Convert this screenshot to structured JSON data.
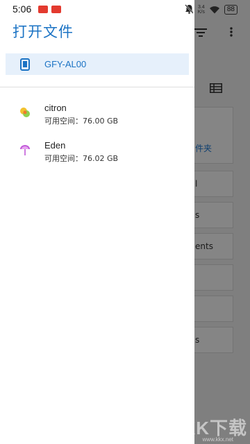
{
  "status_bar": {
    "time": "5:06",
    "app_badges": [
      "",
      ""
    ],
    "net_speed_value": "3.4",
    "net_speed_unit": "K/s",
    "battery": "88",
    "icons": [
      "mute-icon",
      "wifi-icon",
      "battery-icon"
    ]
  },
  "drawer": {
    "title": "打开文件",
    "device": {
      "label": "GFY-AL00",
      "icon": "phone-icon"
    },
    "volumes": [
      {
        "name": "citron",
        "space": "可用空间：76.00 GB",
        "icon": "citron-icon"
      },
      {
        "name": "Eden",
        "space": "可用空间：76.02 GB",
        "icon": "eden-icon"
      }
    ]
  },
  "background_app": {
    "cards": [
      "件夹",
      "l",
      "s",
      "ents",
      "",
      "",
      "s"
    ],
    "top_icons": [
      "sort-icon",
      "more-icon",
      "list-view-icon"
    ]
  },
  "watermark": {
    "text": "KK下载",
    "url": "www.kkx.net"
  },
  "colors": {
    "accent": "#1b73c4",
    "selected_bg": "#e6f0fb"
  }
}
